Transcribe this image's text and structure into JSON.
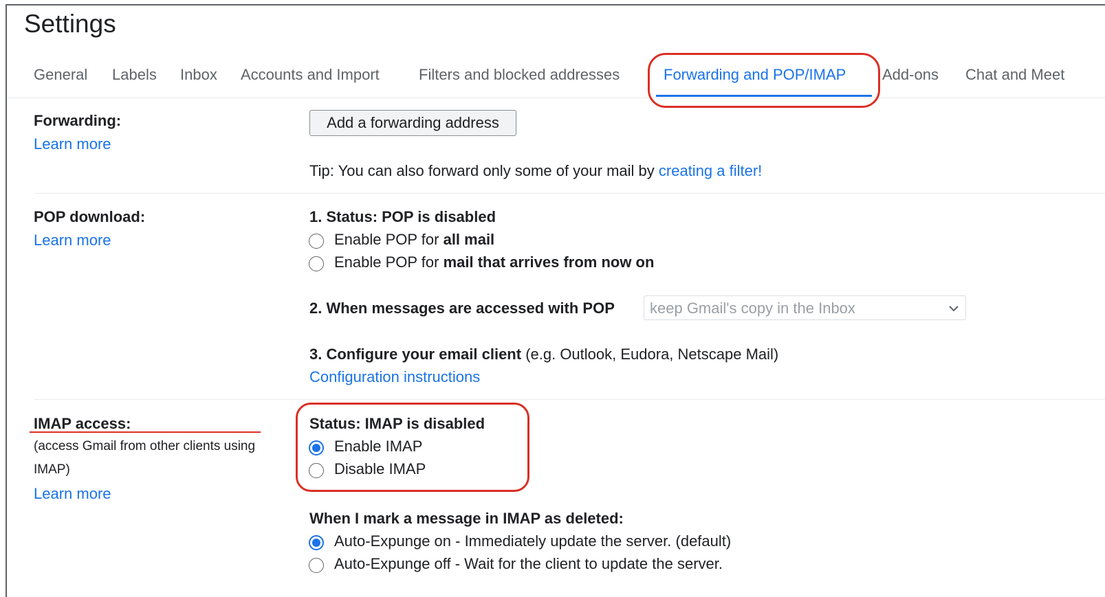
{
  "page": {
    "title": "Settings"
  },
  "tabs": [
    {
      "label": "General"
    },
    {
      "label": "Labels"
    },
    {
      "label": "Inbox"
    },
    {
      "label": "Accounts and Import"
    },
    {
      "label": "Filters and blocked addresses"
    },
    {
      "label": "Forwarding and POP/IMAP",
      "active": true
    },
    {
      "label": "Add-ons"
    },
    {
      "label": "Chat and Meet"
    }
  ],
  "forwarding": {
    "label": "Forwarding:",
    "learn_more": "Learn more",
    "button": "Add a forwarding address",
    "tip_prefix": "Tip: You can also forward only some of your mail by ",
    "tip_link": "creating a filter!"
  },
  "pop": {
    "label": "POP download:",
    "learn_more": "Learn more",
    "status": "1. Status: POP is disabled",
    "option1_prefix": "Enable POP for ",
    "option1_bold": "all mail",
    "option2_prefix": "Enable POP for ",
    "option2_bold": "mail that arrives from now on",
    "step2_label": "2. When messages are accessed with POP",
    "step2_select": "keep Gmail's copy in the Inbox",
    "step3_bold": "3. Configure your email client",
    "step3_rest": " (e.g. Outlook, Eudora, Netscape Mail)",
    "config_link": "Configuration instructions"
  },
  "imap": {
    "label": "IMAP access:",
    "desc_line1": "(access Gmail from other clients using",
    "desc_line2": "IMAP)",
    "learn_more": "Learn more",
    "status": "Status: IMAP is disabled",
    "enable": "Enable IMAP",
    "disable": "Disable IMAP",
    "selected": "enable",
    "deleted_heading": "When I mark a message in IMAP as deleted:",
    "expunge_on": "Auto-Expunge on - Immediately update the server. (default)",
    "expunge_off": "Auto-Expunge off - Wait for the client to update the server.",
    "expunge_selected": "on"
  },
  "colors": {
    "accent": "#1a73e8",
    "highlight": "#d93025"
  },
  "icons": {
    "select": "chevron-down-icon"
  }
}
